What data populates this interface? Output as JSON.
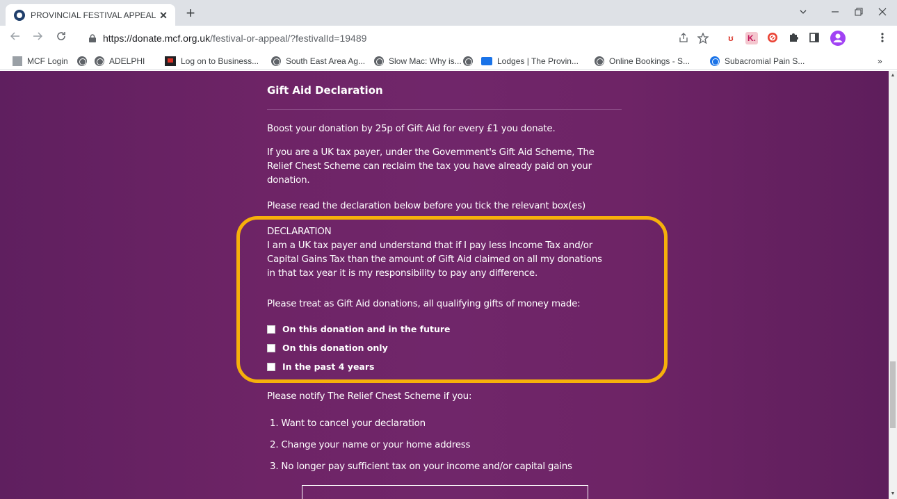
{
  "browser": {
    "tab_title": "PROVINCIAL FESTIVAL APPEAL - |",
    "tab_close": "✕",
    "new_tab": "+",
    "url_host": "https://donate.mcf.org.uk",
    "url_path": "/festival-or-appeal/?festivalId=19489",
    "bookmarks": [
      "MCF Login",
      "",
      "ADELPHI",
      "Log on to Business...",
      "South East Area Ag...",
      "Slow Mac: Why is...",
      "",
      "Lodges | The Provin...",
      "Online Bookings - S...",
      "Subacromial Pain S..."
    ],
    "bookmarks_more": "»"
  },
  "form": {
    "heading": "Gift Aid Declaration",
    "boost_text": "Boost your donation by 25p of Gift Aid for every £1 you donate.",
    "uk_tax_text": "If you are a UK tax payer, under the Government's Gift Aid Scheme, The Relief Chest Scheme can reclaim the tax you have already paid on your donation.",
    "read_text": "Please read the declaration below before you tick the relevant box(es)",
    "declaration_title": "DECLARATION",
    "declaration_text": "I am a UK tax payer and understand that if I pay less Income Tax and/or Capital Gains Tax than the amount of Gift Aid claimed on all my donations in that tax year it is my responsibility to pay any difference.",
    "treat_text": "Please treat as Gift Aid donations, all qualifying gifts of money made:",
    "options": [
      "On this donation and in the future",
      "On this donation only",
      "In the past 4 years"
    ],
    "notify_text": "Please notify The Relief Chest Scheme if you:",
    "notify_items": [
      "1. Want to cancel your declaration",
      "2. Change your name or your home address",
      "3. No longer pay sufficient tax on your income and/or capital gains"
    ]
  },
  "colors": {
    "page_bg": "#6e2466",
    "highlight": "#f6b00b"
  }
}
